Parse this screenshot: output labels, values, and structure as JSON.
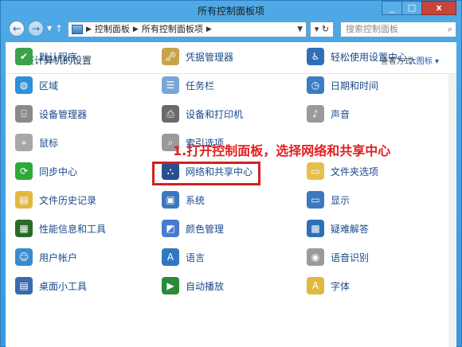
{
  "window": {
    "title": "所有控制面板项",
    "min": "_",
    "max": "□",
    "close": "x"
  },
  "nav": {
    "back": "←",
    "forward": "→",
    "dropdown": "▼",
    "up": "↑",
    "address": [
      "控制面板",
      "所有控制面板项"
    ],
    "address_sep": "▶",
    "refresh": "▾ ↻",
    "search_placeholder": "搜索控制面板",
    "search_glyph": "⌕"
  },
  "header": {
    "title": "调整计算机的设置",
    "view_by": "查看方式:",
    "view_value": "大图标 ▾"
  },
  "annotation": "1.打开控制面板，选择网络和共享中心",
  "items": [
    {
      "label": "默认程序",
      "icon": "default-programs-icon",
      "color": "#3aa34a",
      "glyph": "✔"
    },
    {
      "label": "凭据管理器",
      "icon": "credential-manager-icon",
      "color": "#c8a24a",
      "glyph": "🗝"
    },
    {
      "label": "轻松使用设置中心",
      "icon": "ease-of-access-icon",
      "color": "#2f6fb8",
      "glyph": "♿"
    },
    {
      "label": "区域",
      "icon": "region-icon",
      "color": "#2f8fd8",
      "glyph": "◍"
    },
    {
      "label": "任务栏",
      "icon": "taskbar-icon",
      "color": "#7aa6d6",
      "glyph": "☰"
    },
    {
      "label": "日期和时间",
      "icon": "date-time-icon",
      "color": "#3a7fc4",
      "glyph": "◷"
    },
    {
      "label": "设备管理器",
      "icon": "device-manager-icon",
      "color": "#8a8a8a",
      "glyph": "⌸"
    },
    {
      "label": "设备和打印机",
      "icon": "devices-printers-icon",
      "color": "#6a6a6a",
      "glyph": "⎙"
    },
    {
      "label": "声音",
      "icon": "sound-icon",
      "color": "#9a9a9a",
      "glyph": "♪"
    },
    {
      "label": "鼠标",
      "icon": "mouse-icon",
      "color": "#a8a8a8",
      "glyph": "⌖"
    },
    {
      "label": "索引选项",
      "icon": "indexing-options-icon",
      "color": "#9a9a9a",
      "glyph": "⌕"
    },
    {
      "label": "",
      "icon": "empty-slot",
      "color": "#ffffff",
      "glyph": ""
    },
    {
      "label": "同步中心",
      "icon": "sync-center-icon",
      "color": "#2faa3a",
      "glyph": "⟳"
    },
    {
      "label": "网络和共享中心",
      "icon": "network-sharing-icon",
      "color": "#2a4f8f",
      "glyph": "⛬"
    },
    {
      "label": "文件夹选项",
      "icon": "folder-options-icon",
      "color": "#e6c04a",
      "glyph": "▭"
    },
    {
      "label": "文件历史记录",
      "icon": "file-history-icon",
      "color": "#e2b840",
      "glyph": "▤"
    },
    {
      "label": "系统",
      "icon": "system-icon",
      "color": "#3a78c0",
      "glyph": "▣"
    },
    {
      "label": "显示",
      "icon": "display-icon",
      "color": "#3a78c0",
      "glyph": "▭"
    },
    {
      "label": "性能信息和工具",
      "icon": "performance-icon",
      "color": "#2a6a2a",
      "glyph": "▦"
    },
    {
      "label": "颜色管理",
      "icon": "color-management-icon",
      "color": "#4a7ad0",
      "glyph": "◩"
    },
    {
      "label": "疑难解答",
      "icon": "troubleshooting-icon",
      "color": "#2f6fb8",
      "glyph": "▩"
    },
    {
      "label": "用户帐户",
      "icon": "user-accounts-icon",
      "color": "#3a8ad0",
      "glyph": "☺"
    },
    {
      "label": "语言",
      "icon": "language-icon",
      "color": "#2f78c0",
      "glyph": "A"
    },
    {
      "label": "语音识别",
      "icon": "speech-recognition-icon",
      "color": "#9a9a9a",
      "glyph": "◉"
    },
    {
      "label": "桌面小工具",
      "icon": "desktop-gadgets-icon",
      "color": "#3a6ab0",
      "glyph": "▤"
    },
    {
      "label": "自动播放",
      "icon": "autoplay-icon",
      "color": "#2a8a3a",
      "glyph": "▶"
    },
    {
      "label": "字体",
      "icon": "fonts-icon",
      "color": "#e0b840",
      "glyph": "A"
    }
  ]
}
